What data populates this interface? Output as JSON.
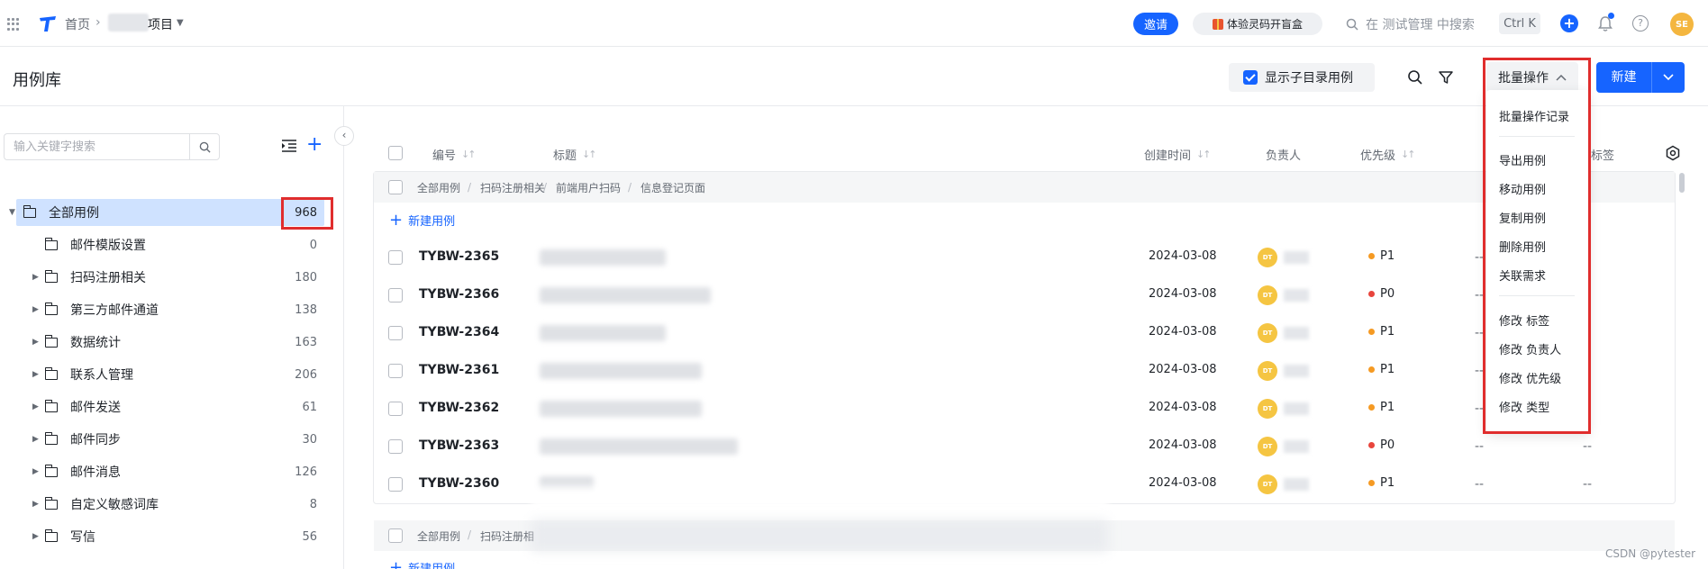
{
  "topbar": {
    "home": "首页",
    "project_suffix": "项目",
    "invite": "邀请",
    "gift": "体验灵码开盲盒",
    "search_placeholder": "在 测试管理 中搜索",
    "shortcut": "Ctrl K",
    "avatar": "SE"
  },
  "header": {
    "title": "用例库",
    "show_sub": "显示子目录用例",
    "batch": "批量操作",
    "new": "新建"
  },
  "sidebar": {
    "search_placeholder": "输入关键字搜索",
    "items": [
      {
        "name": "全部用例",
        "count": "968"
      },
      {
        "name": "邮件模版设置",
        "count": "0"
      },
      {
        "name": "扫码注册相关",
        "count": "180"
      },
      {
        "name": "第三方邮件通道",
        "count": "138"
      },
      {
        "name": "数据统计",
        "count": "163"
      },
      {
        "name": "联系人管理",
        "count": "206"
      },
      {
        "name": "邮件发送",
        "count": "61"
      },
      {
        "name": "邮件同步",
        "count": "30"
      },
      {
        "name": "邮件消息",
        "count": "126"
      },
      {
        "name": "自定义敏感词库",
        "count": "8"
      },
      {
        "name": "写信",
        "count": "56"
      }
    ]
  },
  "table": {
    "headers": {
      "code": "编号",
      "title": "标题",
      "created": "创建时间",
      "owner": "负责人",
      "priority": "优先级",
      "tag": "标签"
    },
    "group1": [
      "全部用例",
      "扫码注册相关",
      "前端用户扫码",
      "信息登记页面"
    ],
    "group2": [
      "全部用例",
      "扫码注册相"
    ],
    "new_case": "新建用例",
    "rows": [
      {
        "code": "TYBW-2365",
        "date": "2024-03-08",
        "avatar": "DT",
        "priority": "P1"
      },
      {
        "code": "TYBW-2366",
        "date": "2024-03-08",
        "avatar": "DT",
        "priority": "P0"
      },
      {
        "code": "TYBW-2364",
        "date": "2024-03-08",
        "avatar": "DT",
        "priority": "P1"
      },
      {
        "code": "TYBW-2361",
        "date": "2024-03-08",
        "avatar": "DT",
        "priority": "P1"
      },
      {
        "code": "TYBW-2362",
        "date": "2024-03-08",
        "avatar": "DT",
        "priority": "P1"
      },
      {
        "code": "TYBW-2363",
        "date": "2024-03-08",
        "avatar": "DT",
        "priority": "P0"
      },
      {
        "code": "TYBW-2360",
        "date": "2024-03-08",
        "avatar": "DT",
        "priority": "P1"
      }
    ],
    "dash": "--"
  },
  "dropdown": {
    "items": [
      "批量操作记录",
      "导出用例",
      "移动用例",
      "复制用例",
      "删除用例",
      "关联需求",
      "修改 标签",
      "修改 负责人",
      "修改 优先级",
      "修改 类型"
    ]
  },
  "colors": {
    "accent": "#1664ff",
    "p0": "#e8453c",
    "p1": "#f59a23",
    "highlight": "#e02d2d"
  },
  "watermark": "CSDN @pytester"
}
